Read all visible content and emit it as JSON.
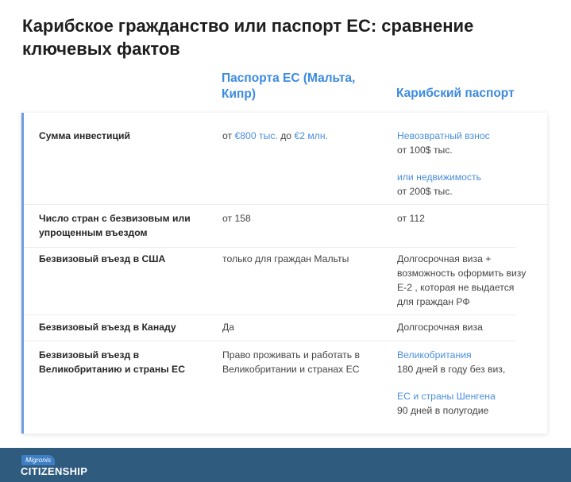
{
  "title": "Карибское гражданство или паспорт ЕС: сравнение ключевых фактов",
  "columns": {
    "eu": "Паспорта ЕС (Мальта, Кипр)",
    "carib": "Карибский паспорт"
  },
  "rows": [
    {
      "label": "Сумма инвестиций",
      "eu": {
        "p1": "от ",
        "amount1": "€800 тыс.",
        "p2": " до ",
        "amount2": "€2 млн."
      },
      "carib": {
        "line1_blue": "Невозвратный взнос",
        "line2": "от 100$ тыс.",
        "line3_blue": "или недвижимость",
        "line4": "от 200$ тыс."
      }
    },
    {
      "label": "Число стран с безвизовым или упрощенным въездом",
      "eu": "от 158",
      "carib": "от 112"
    },
    {
      "label": "Безвизовый  въезд в США",
      "eu": "только для граждан Мальты",
      "carib": "Долгосрочная виза + возможность оформить визу Е-2 , которая не выдается для граждан РФ"
    },
    {
      "label": "Безвизовый въезд в Канаду",
      "eu": "Да",
      "carib": "Долгосрочная виза"
    },
    {
      "label": "Безвизовый въезд в Великобританию и страны ЕС",
      "eu": "Право проживать и работать в Великобритании и странах ЕС",
      "carib": {
        "line1_blue": "Великобритания",
        "line2": "180 дней в году без виз,",
        "line3_blue": "ЕС и страны Шенгена",
        "line4": "90 дней в полугодие"
      }
    }
  ],
  "footer": {
    "brand_tag": "Migronis",
    "brand_main": "CITIZENSHIP"
  },
  "colors": {
    "accent": "#3d8be0",
    "link": "#4b8fdc",
    "footer": "#2f5b7e"
  }
}
